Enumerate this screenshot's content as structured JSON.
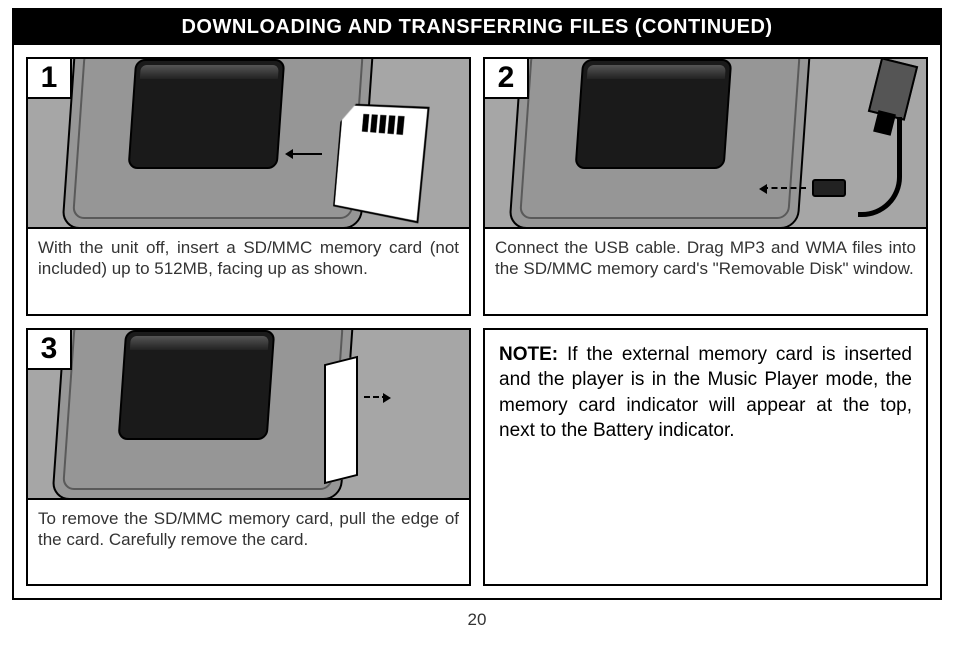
{
  "title": "DOWNLOADING AND TRANSFERRING FILES (CONTINUED)",
  "steps": {
    "s1": {
      "num": "1",
      "caption": "With the unit off, insert a SD/MMC memory card (not included) up to 512MB, facing up as shown."
    },
    "s2": {
      "num": "2",
      "caption": "Connect the USB cable. Drag MP3 and WMA files into the SD/MMC memory card's \"Removable Disk\" window."
    },
    "s3": {
      "num": "3",
      "caption": "To remove the SD/MMC memory card, pull the edge of the card. Carefully remove the card."
    }
  },
  "note": {
    "label": "NOTE:",
    "text": " If the external memory card is inserted and the player is in the Music Player mode, the memory card indicator will appear at the top, next to the Battery indicator."
  },
  "page_number": "20"
}
